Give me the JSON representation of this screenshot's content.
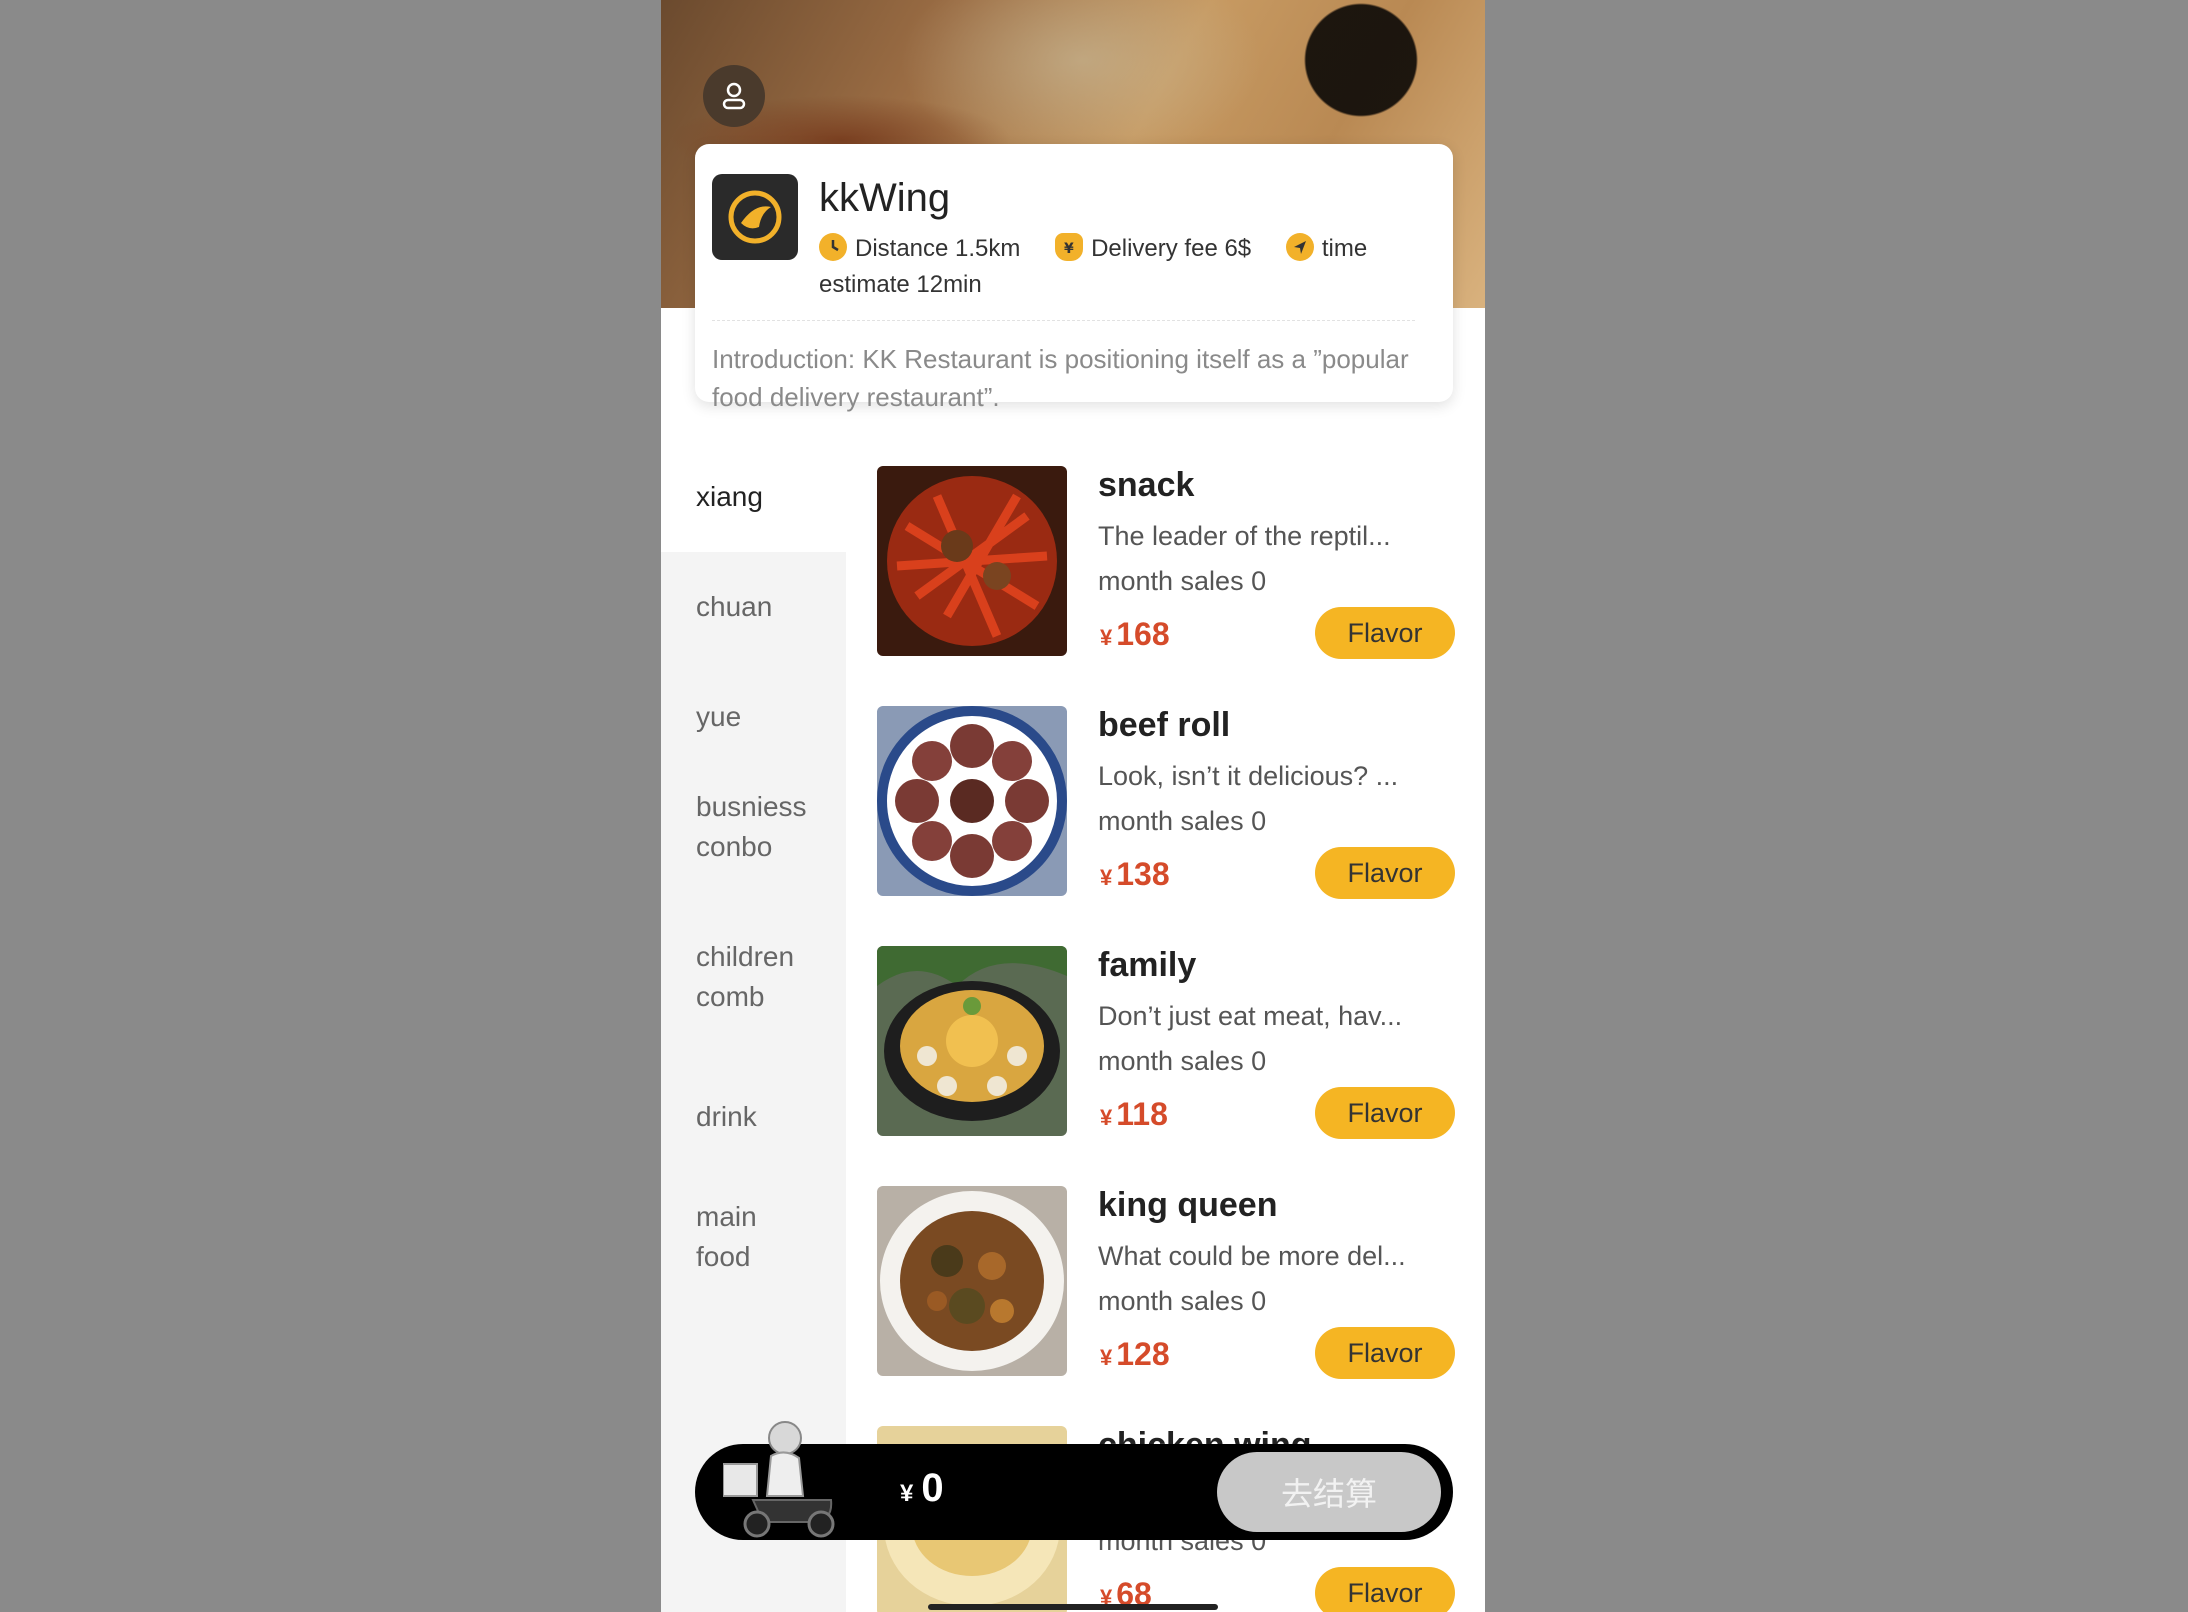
{
  "shop": {
    "name": "kkWing",
    "distance": "Distance 1.5km",
    "delivery_fee": "Delivery fee 6$",
    "time_estimate": "time estimate 12min",
    "introduction": "Introduction: KK Restaurant is positioning itself as a ”popular food delivery restaurant”."
  },
  "categories": [
    {
      "label": "xiang",
      "active": true
    },
    {
      "label": "chuan"
    },
    {
      "label": "yue"
    },
    {
      "label": "busniess conbo"
    },
    {
      "label": "children comb"
    },
    {
      "label": "drink"
    },
    {
      "label": "main food"
    }
  ],
  "dishes": [
    {
      "name": "snack",
      "desc": "The leader of the reptil...",
      "sales": "month sales 0",
      "currency": "¥",
      "price": "168",
      "flavor": "Flavor"
    },
    {
      "name": "beef roll",
      "desc": "Look, isn’t it delicious? ...",
      "sales": "month sales 0",
      "currency": "¥",
      "price": "138",
      "flavor": "Flavor"
    },
    {
      "name": "family",
      "desc": "Don’t just eat meat, hav...",
      "sales": "month sales 0",
      "currency": "¥",
      "price": "118",
      "flavor": "Flavor"
    },
    {
      "name": "king queen",
      "desc": "What could be more del...",
      "sales": "month sales 0",
      "currency": "¥",
      "price": "128",
      "flavor": "Flavor"
    },
    {
      "name": "chicken wing",
      "desc": "",
      "sales": "month sales 0",
      "currency": "¥",
      "price": "68",
      "flavor": "Flavor"
    }
  ],
  "cart": {
    "currency": "¥",
    "total": "0",
    "checkout_label": "去结算"
  },
  "colors": {
    "accent": "#f5b523",
    "price": "#d54b2a",
    "cart_bg": "#000000"
  },
  "icons": {
    "profile": "user-icon",
    "distance": "clock-icon",
    "fee": "money-bag-icon",
    "time": "navigation-arrow-icon"
  }
}
